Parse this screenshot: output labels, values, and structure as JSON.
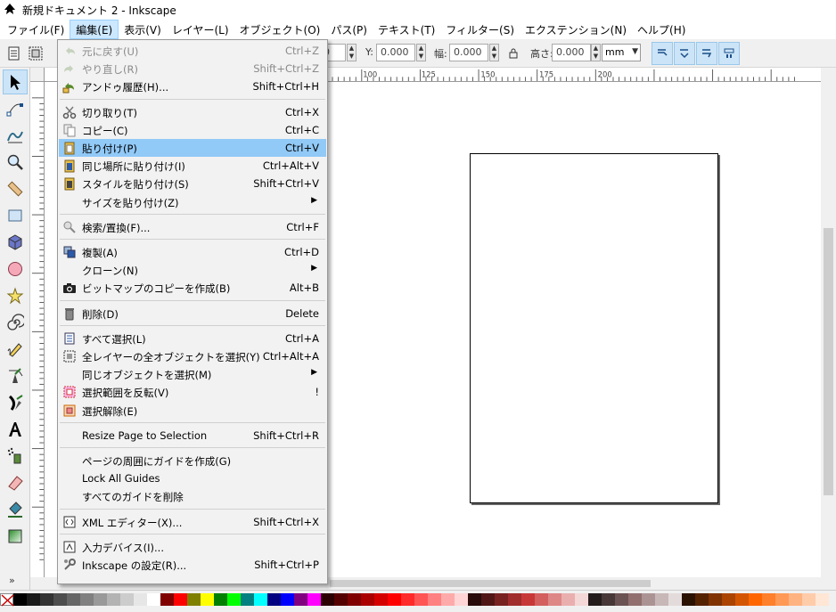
{
  "window": {
    "title": "新規ドキュメント 2 - Inkscape"
  },
  "menubar": [
    {
      "label": "ファイル(F)"
    },
    {
      "label": "編集(E)"
    },
    {
      "label": "表示(V)"
    },
    {
      "label": "レイヤー(L)"
    },
    {
      "label": "オブジェクト(O)"
    },
    {
      "label": "パス(P)"
    },
    {
      "label": "テキスト(T)"
    },
    {
      "label": "フィルター(S)"
    },
    {
      "label": "エクステンション(N)"
    },
    {
      "label": "ヘルプ(H)"
    }
  ],
  "toolbar": {
    "x_partial": "0",
    "y_label": "Y:",
    "y_value": "0.000",
    "w_label": "幅:",
    "w_value": "0.000",
    "h_label": "高さ:",
    "h_value": "0.000",
    "unit": "mm"
  },
  "ruler_h_labels": [
    "100",
    "125",
    "150",
    "175",
    "200"
  ],
  "edit_menu": [
    {
      "label": "元に戻す(U)",
      "shortcut": "Ctrl+Z",
      "icon": "undo-icon",
      "disabled": true
    },
    {
      "label": "やり直し(R)",
      "shortcut": "Shift+Ctrl+Z",
      "icon": "redo-icon",
      "disabled": true
    },
    {
      "label": "アンドゥ履歴(H)...",
      "shortcut": "Shift+Ctrl+H",
      "icon": "undo-history-icon"
    },
    {
      "sep": true
    },
    {
      "label": "切り取り(T)",
      "shortcut": "Ctrl+X",
      "icon": "cut-icon"
    },
    {
      "label": "コピー(C)",
      "shortcut": "Ctrl+C",
      "icon": "copy-icon"
    },
    {
      "label": "貼り付け(P)",
      "shortcut": "Ctrl+V",
      "icon": "paste-icon",
      "highlight": true
    },
    {
      "label": "同じ場所に貼り付け(I)",
      "shortcut": "Ctrl+Alt+V",
      "icon": "paste-in-place-icon"
    },
    {
      "label": "スタイルを貼り付け(S)",
      "shortcut": "Shift+Ctrl+V",
      "icon": "paste-style-icon"
    },
    {
      "label": "サイズを貼り付け(Z)",
      "submenu": true
    },
    {
      "sep": true
    },
    {
      "label": "検索/置換(F)...",
      "shortcut": "Ctrl+F",
      "icon": "find-icon"
    },
    {
      "sep": true
    },
    {
      "label": "複製(A)",
      "shortcut": "Ctrl+D",
      "icon": "duplicate-icon"
    },
    {
      "label": "クローン(N)",
      "submenu": true
    },
    {
      "label": "ビットマップのコピーを作成(B)",
      "shortcut": "Alt+B",
      "icon": "camera-icon"
    },
    {
      "sep": true
    },
    {
      "label": "削除(D)",
      "shortcut": "Delete",
      "icon": "delete-icon"
    },
    {
      "sep": true
    },
    {
      "label": "すべて選択(L)",
      "shortcut": "Ctrl+A",
      "icon": "select-all-icon"
    },
    {
      "label": "全レイヤーの全オブジェクトを選択(Y)",
      "shortcut": "Ctrl+Alt+A",
      "icon": "select-all-layers-icon"
    },
    {
      "label": "同じオブジェクトを選択(M)",
      "submenu": true
    },
    {
      "label": "選択範囲を反転(V)",
      "shortcut": "!",
      "icon": "invert-selection-icon"
    },
    {
      "label": "選択解除(E)",
      "icon": "deselect-icon"
    },
    {
      "sep": true
    },
    {
      "label": "Resize Page to Selection",
      "shortcut": "Shift+Ctrl+R"
    },
    {
      "sep": true
    },
    {
      "label": "ページの周囲にガイドを作成(G)"
    },
    {
      "label": "Lock All Guides"
    },
    {
      "label": "すべてのガイドを削除"
    },
    {
      "sep": true
    },
    {
      "label": "XML エディター(X)...",
      "shortcut": "Shift+Ctrl+X",
      "icon": "xml-editor-icon"
    },
    {
      "sep": true
    },
    {
      "label": "入力デバイス(I)...",
      "icon": "input-devices-icon"
    },
    {
      "label": "Inkscape の設定(R)...",
      "shortcut": "Shift+Ctrl+P",
      "icon": "preferences-icon"
    }
  ],
  "palette_colors": [
    "#000000",
    "#1a1a1a",
    "#333333",
    "#4d4d4d",
    "#666666",
    "#808080",
    "#999999",
    "#b3b3b3",
    "#cccccc",
    "#e6e6e6",
    "#ffffff",
    "#800000",
    "#ff0000",
    "#808000",
    "#ffff00",
    "#008000",
    "#00ff00",
    "#008080",
    "#00ffff",
    "#000080",
    "#0000ff",
    "#800080",
    "#ff00ff",
    "#2b0000",
    "#550000",
    "#800000",
    "#aa0000",
    "#d40000",
    "#ff0000",
    "#ff2a2a",
    "#ff5555",
    "#ff8080",
    "#ffaaaa",
    "#ffd5d5",
    "#280b0b",
    "#501616",
    "#782121",
    "#a02c2c",
    "#c83737",
    "#d35f5f",
    "#de8787",
    "#e9afaf",
    "#f4d7d7",
    "#241c1c",
    "#483737",
    "#6c5353",
    "#916f6f",
    "#ac9393",
    "#c8b7b7",
    "#e3dbdb",
    "#2b1100",
    "#552200",
    "#803300",
    "#aa4400",
    "#d45500",
    "#ff6600",
    "#ff7f2a",
    "#ff9955",
    "#ffb380",
    "#ffccaa",
    "#ffe6d5"
  ]
}
